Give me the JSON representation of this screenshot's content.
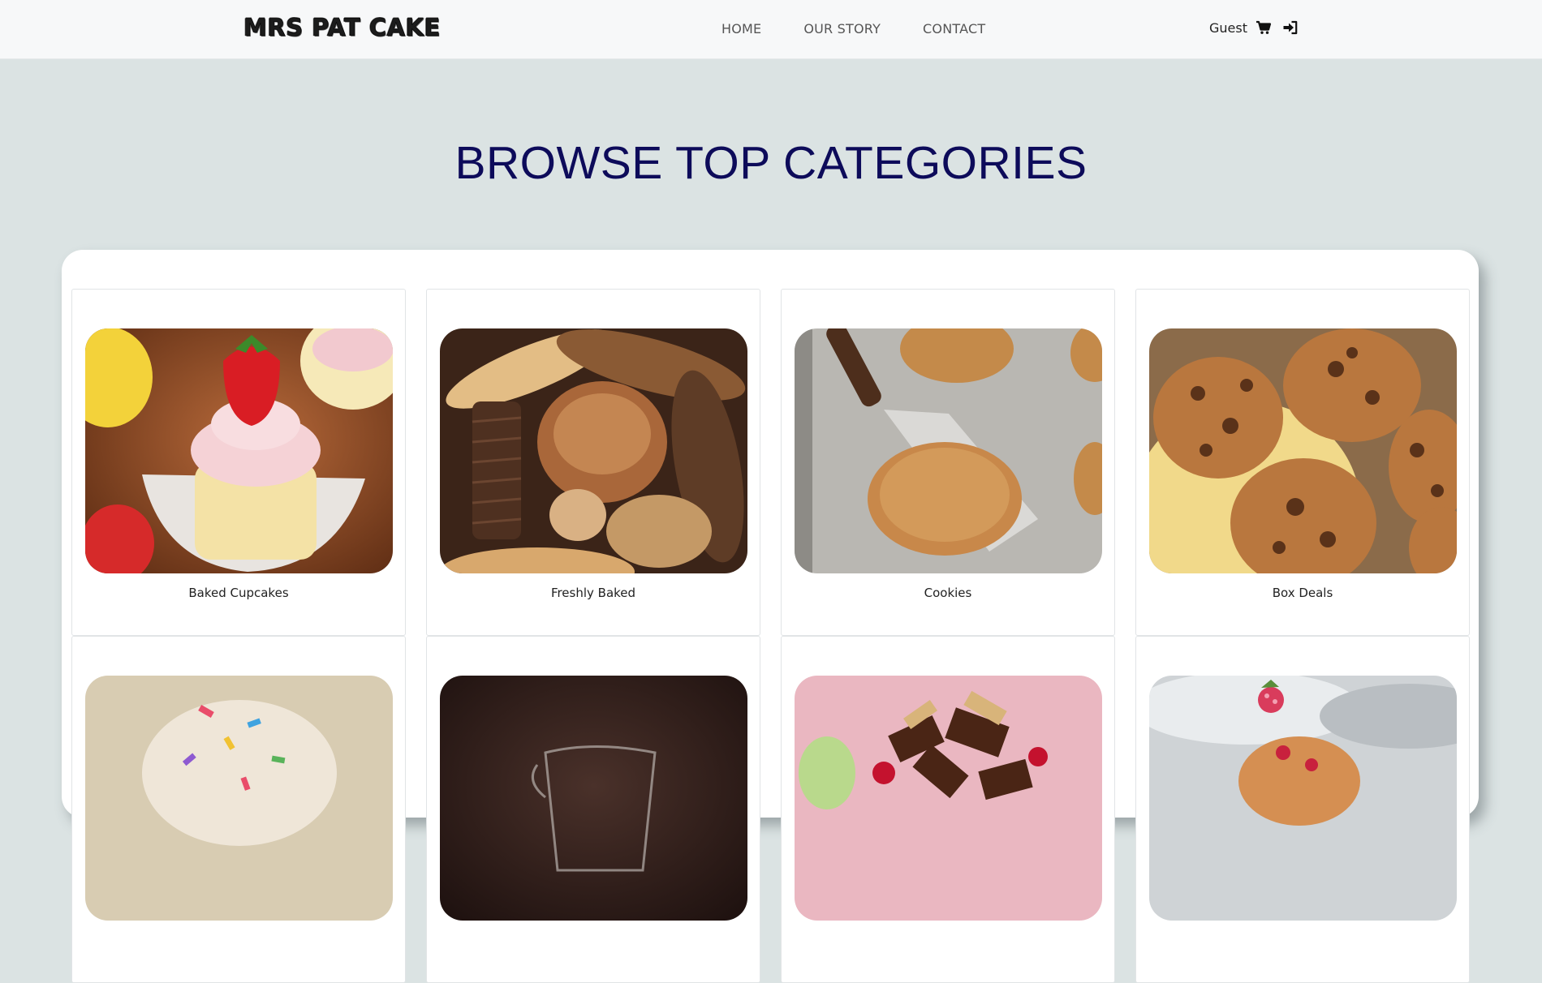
{
  "brand": {
    "name": "MRS PAT CAKE"
  },
  "nav": {
    "links": [
      {
        "label": "HOME"
      },
      {
        "label": "OUR STORY"
      },
      {
        "label": "CONTACT"
      }
    ],
    "user_label": "Guest",
    "icons": [
      "shopping-cart-icon",
      "sign-in-icon"
    ]
  },
  "hero": {
    "title": "BROWSE TOP CATEGORIES"
  },
  "categories": [
    {
      "label": "Baked Cupcakes",
      "image": "cupcake-with-strawberry"
    },
    {
      "label": "Freshly Baked",
      "image": "assorted-bread-loaves"
    },
    {
      "label": "Cookies",
      "image": "cookies-on-spatula"
    },
    {
      "label": "Box Deals",
      "image": "chocolate-chip-cookies-plate"
    },
    {
      "label": "",
      "image": "sprinkle-bark-on-tray"
    },
    {
      "label": "",
      "image": "glass-pitcher-dark-background"
    },
    {
      "label": "",
      "image": "chocolate-bark-with-berries"
    },
    {
      "label": "",
      "image": "raspberry-muffin"
    }
  ],
  "colors": {
    "page_background": "#dbe3e3",
    "navbar_background": "#f7f8f9",
    "title_color": "#0d0b5a",
    "panel_background": "#ffffff"
  }
}
